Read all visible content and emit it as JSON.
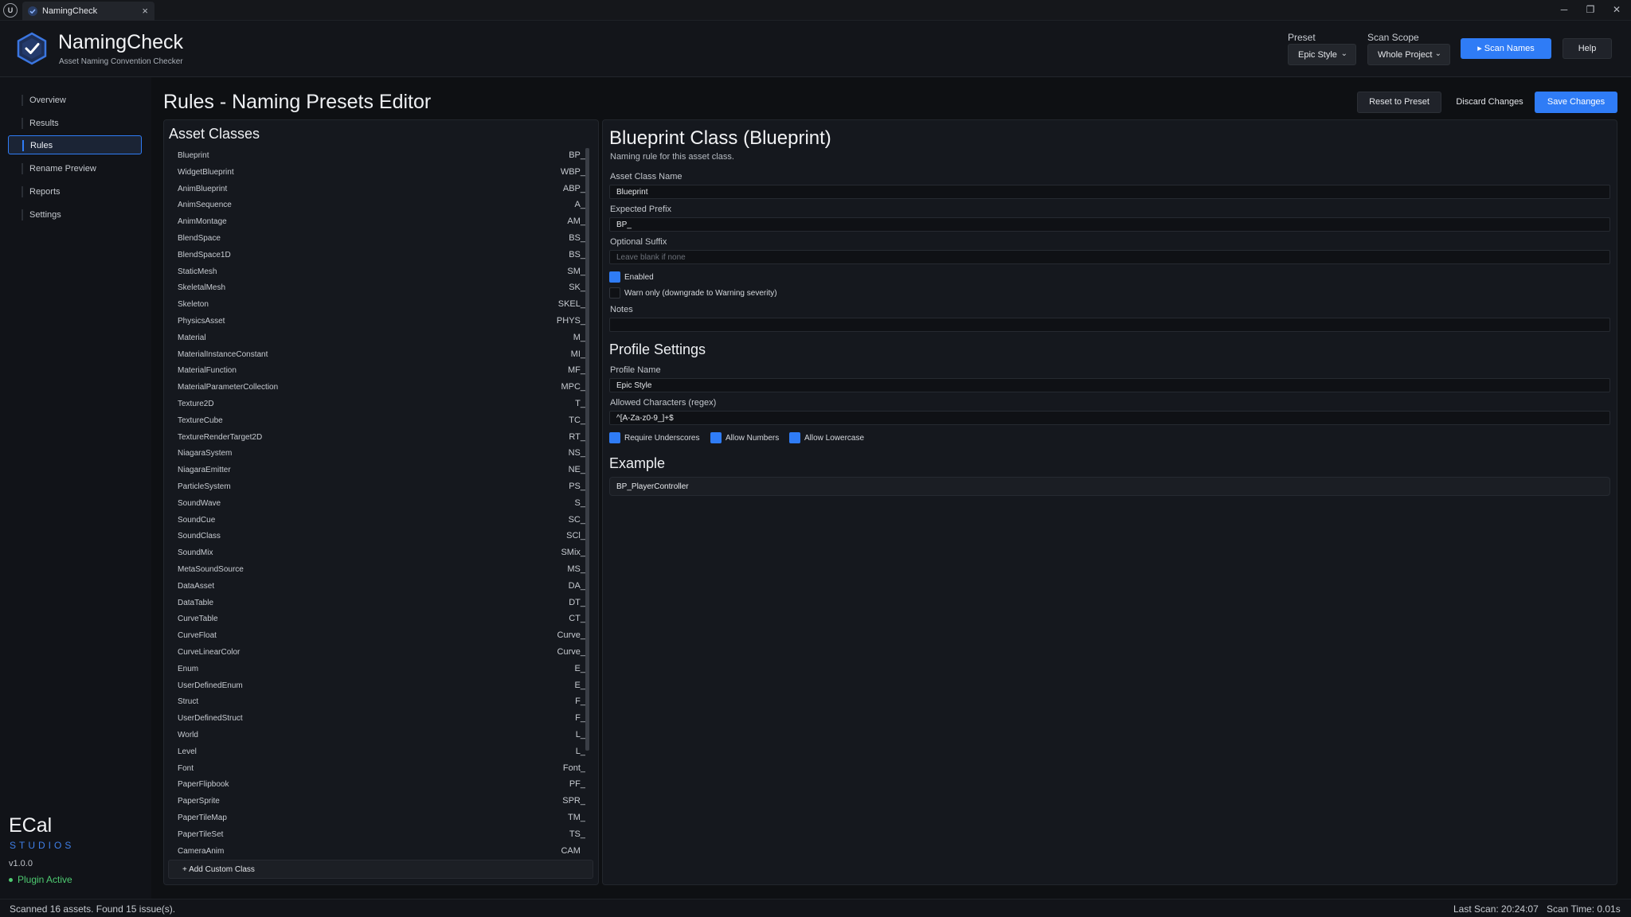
{
  "window": {
    "tab_title": "NamingCheck",
    "tab_close": "×",
    "minimize": "─",
    "restore": "❐",
    "close": "✕",
    "engine_logo_text": "U"
  },
  "header": {
    "app_title": "NamingCheck",
    "app_subtitle": "Asset Naming Convention Checker",
    "preset_label": "Preset",
    "preset_value": "Epic Style",
    "scope_label": "Scan Scope",
    "scope_value": "Whole Project",
    "scan_button": "▸ Scan Names",
    "help_button": "Help",
    "accent_color": "#2f7cf6"
  },
  "sidebar": {
    "items": [
      {
        "label": "Overview",
        "active": false
      },
      {
        "label": "Results",
        "active": false
      },
      {
        "label": "Rules",
        "active": true
      },
      {
        "label": "Rename Preview",
        "active": false
      },
      {
        "label": "Reports",
        "active": false
      },
      {
        "label": "Settings",
        "active": false
      }
    ],
    "brand_name": "ECal",
    "brand_sub": "STUDIOS",
    "version": "v1.0.0",
    "plugin_status": "Plugin Active"
  },
  "page": {
    "title": "Rules - Naming Presets Editor",
    "reset_button": "Reset to Preset",
    "discard_button": "Discard Changes",
    "save_button": "Save Changes"
  },
  "asset_classes": {
    "title": "Asset Classes",
    "add_button": "+ Add Custom Class",
    "rows": [
      {
        "name": "Blueprint",
        "prefix": "BP_"
      },
      {
        "name": "WidgetBlueprint",
        "prefix": "WBP_"
      },
      {
        "name": "AnimBlueprint",
        "prefix": "ABP_"
      },
      {
        "name": "AnimSequence",
        "prefix": "A_"
      },
      {
        "name": "AnimMontage",
        "prefix": "AM_"
      },
      {
        "name": "BlendSpace",
        "prefix": "BS_"
      },
      {
        "name": "BlendSpace1D",
        "prefix": "BS_"
      },
      {
        "name": "StaticMesh",
        "prefix": "SM_"
      },
      {
        "name": "SkeletalMesh",
        "prefix": "SK_"
      },
      {
        "name": "Skeleton",
        "prefix": "SKEL_"
      },
      {
        "name": "PhysicsAsset",
        "prefix": "PHYS_"
      },
      {
        "name": "Material",
        "prefix": "M_"
      },
      {
        "name": "MaterialInstanceConstant",
        "prefix": "MI_"
      },
      {
        "name": "MaterialFunction",
        "prefix": "MF_"
      },
      {
        "name": "MaterialParameterCollection",
        "prefix": "MPC_"
      },
      {
        "name": "Texture2D",
        "prefix": "T_"
      },
      {
        "name": "TextureCube",
        "prefix": "TC_"
      },
      {
        "name": "TextureRenderTarget2D",
        "prefix": "RT_"
      },
      {
        "name": "NiagaraSystem",
        "prefix": "NS_"
      },
      {
        "name": "NiagaraEmitter",
        "prefix": "NE_"
      },
      {
        "name": "ParticleSystem",
        "prefix": "PS_"
      },
      {
        "name": "SoundWave",
        "prefix": "S_"
      },
      {
        "name": "SoundCue",
        "prefix": "SC_"
      },
      {
        "name": "SoundClass",
        "prefix": "SCl_"
      },
      {
        "name": "SoundMix",
        "prefix": "SMix_"
      },
      {
        "name": "MetaSoundSource",
        "prefix": "MS_"
      },
      {
        "name": "DataAsset",
        "prefix": "DA_"
      },
      {
        "name": "DataTable",
        "prefix": "DT_"
      },
      {
        "name": "CurveTable",
        "prefix": "CT_"
      },
      {
        "name": "CurveFloat",
        "prefix": "Curve_"
      },
      {
        "name": "CurveLinearColor",
        "prefix": "Curve_"
      },
      {
        "name": "Enum",
        "prefix": "E_"
      },
      {
        "name": "UserDefinedEnum",
        "prefix": "E_"
      },
      {
        "name": "Struct",
        "prefix": "F_"
      },
      {
        "name": "UserDefinedStruct",
        "prefix": "F_"
      },
      {
        "name": "World",
        "prefix": "L_"
      },
      {
        "name": "Level",
        "prefix": "L_"
      },
      {
        "name": "Font",
        "prefix": "Font_"
      },
      {
        "name": "PaperFlipbook",
        "prefix": "PF_"
      },
      {
        "name": "PaperSprite",
        "prefix": "SPR_"
      },
      {
        "name": "PaperTileMap",
        "prefix": "TM_"
      },
      {
        "name": "PaperTileSet",
        "prefix": "TS_"
      },
      {
        "name": "CameraAnim",
        "prefix": "CAM_"
      }
    ]
  },
  "editor": {
    "title": "Blueprint Class (Blueprint)",
    "subtitle": "Naming rule for this asset class.",
    "class_name_label": "Asset Class Name",
    "class_name_value": "Blueprint",
    "prefix_label": "Expected Prefix",
    "prefix_value": "BP_",
    "suffix_label": "Optional Suffix",
    "suffix_placeholder": "Leave blank if none",
    "enabled_label": "Enabled",
    "enabled": true,
    "warn_label": "Warn only (downgrade to Warning severity)",
    "warn_only": false,
    "notes_label": "Notes",
    "notes_value": ""
  },
  "profile": {
    "title": "Profile Settings",
    "name_label": "Profile Name",
    "name_value": "Epic Style",
    "regex_label": "Allowed Characters (regex)",
    "regex_value": "^[A-Za-z0-9_]+$",
    "require_underscores_label": "Require Underscores",
    "require_underscores": true,
    "allow_numbers_label": "Allow Numbers",
    "allow_numbers": true,
    "allow_lowercase_label": "Allow Lowercase",
    "allow_lowercase": true
  },
  "example": {
    "title": "Example",
    "value": "BP_PlayerController"
  },
  "status": {
    "left": "Scanned 16 assets. Found 15 issue(s).",
    "last_scan": "Last Scan: 20:24:07",
    "scan_time": "Scan Time: 0.01s"
  }
}
